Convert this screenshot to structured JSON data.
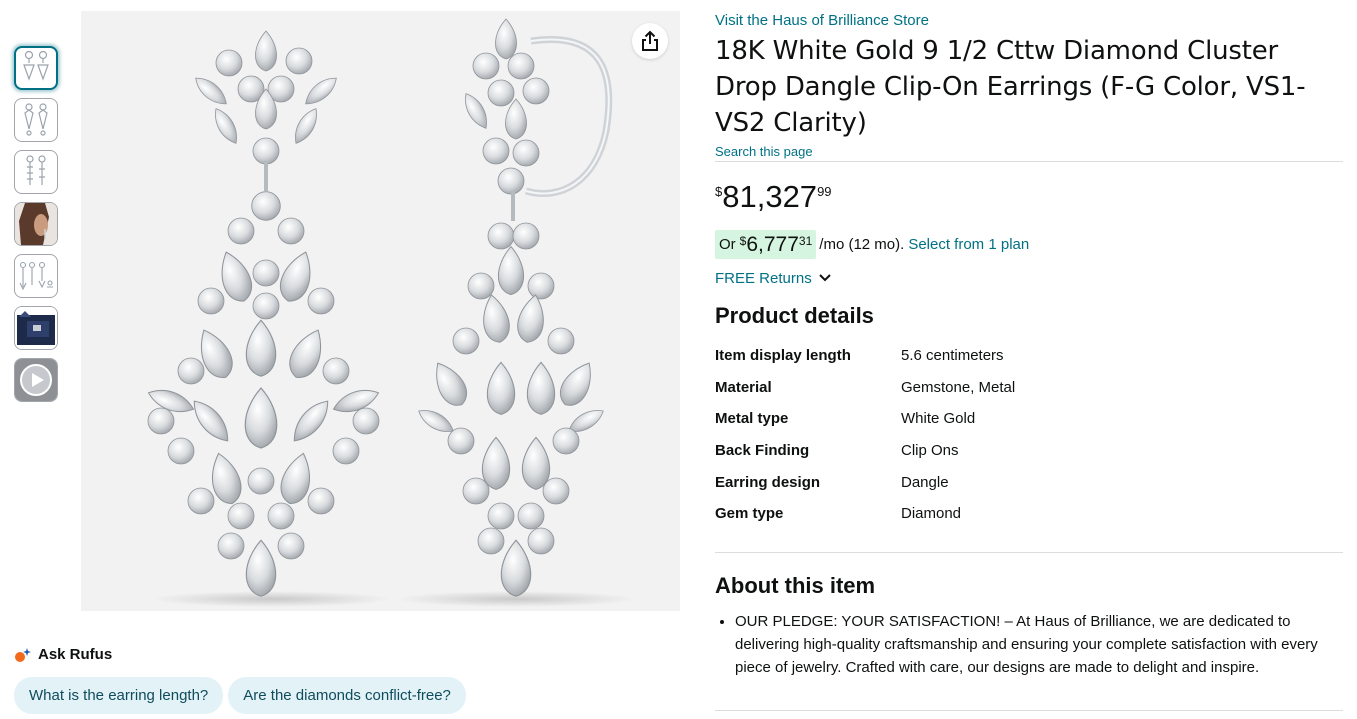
{
  "thumbnails": [
    {
      "icon": "earring-thumb-icon",
      "active": true
    },
    {
      "icon": "earring-thumb-icon",
      "active": false
    },
    {
      "icon": "earring-side-thumb-icon",
      "active": false
    },
    {
      "icon": "model-ear-thumb-icon",
      "active": false
    },
    {
      "icon": "earring-set-thumb-icon",
      "active": false
    },
    {
      "icon": "gift-box-thumb-icon",
      "active": false
    },
    {
      "icon": "video-thumb-icon",
      "active": false
    }
  ],
  "main_image": {
    "icon": "diamond-earrings-image",
    "share_icon": "share-icon"
  },
  "rufus": {
    "label": "Ask Rufus",
    "chips": [
      "What is the earring length?",
      "Are the diamonds conflict-free?"
    ]
  },
  "store_link": "Visit the Haus of Brilliance Store",
  "title": "18K White Gold 9 1/2 Cttw Diamond Cluster Drop Dangle Clip-On Earrings (F-G Color, VS1-VS2 Clarity)",
  "search_page": "Search this page",
  "price": {
    "symbol": "$",
    "whole": "81,327",
    "fraction": "99"
  },
  "monthly": {
    "or": "Or",
    "symbol": "$",
    "whole": "6,777",
    "fraction": "31",
    "term": "/mo (12 mo).",
    "plan_link": "Select from 1 plan"
  },
  "returns": "FREE Returns",
  "product_details": {
    "heading": "Product details",
    "rows": [
      {
        "key": "Item display length",
        "value": "5.6 centimeters"
      },
      {
        "key": "Material",
        "value": "Gemstone, Metal"
      },
      {
        "key": "Metal type",
        "value": "White Gold"
      },
      {
        "key": "Back Finding",
        "value": "Clip Ons"
      },
      {
        "key": "Earring design",
        "value": "Dangle"
      },
      {
        "key": "Gem type",
        "value": "Diamond"
      }
    ]
  },
  "about": {
    "heading": "About this item",
    "bullets": [
      "OUR PLEDGE: YOUR SATISFACTION! – At Haus of Brilliance, we are dedicated to delivering high-quality craftsmanship and ensuring your complete satisfaction with every piece of jewelry. Crafted with care, our designs are made to delight and inspire."
    ]
  },
  "colors": {
    "link": "#007185",
    "monthly_badge": "#d5f5e0",
    "chip_bg": "#e3f2f7",
    "active_thumb": "#007185"
  }
}
